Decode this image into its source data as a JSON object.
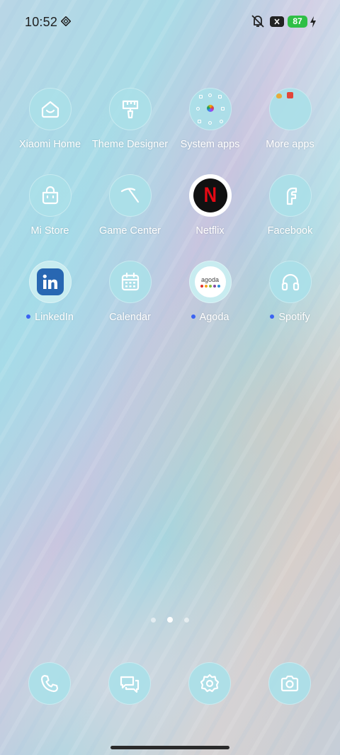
{
  "status_bar": {
    "time": "10:52",
    "icons": [
      "diamond-notification-icon",
      "vibrate-off-icon",
      "x-notification-icon",
      "battery-icon",
      "charging-bolt-icon"
    ],
    "battery_level": "87",
    "battery_color": "#2fbf46"
  },
  "apps": [
    {
      "label": "Xiaomi Home",
      "icon": "xiaomi-home-icon",
      "notification_dot": false
    },
    {
      "label": "Theme Designer",
      "icon": "paint-roller-icon",
      "notification_dot": false
    },
    {
      "label": "System apps",
      "icon": "folder-icon",
      "notification_dot": false
    },
    {
      "label": "More apps",
      "icon": "folder-icon",
      "notification_dot": false
    },
    {
      "label": "Mi Store",
      "icon": "shopping-bag-icon",
      "notification_dot": false
    },
    {
      "label": "Game Center",
      "icon": "game-center-icon",
      "notification_dot": false
    },
    {
      "label": "Netflix",
      "icon": "netflix-icon",
      "notification_dot": false
    },
    {
      "label": "Facebook",
      "icon": "facebook-icon",
      "notification_dot": false
    },
    {
      "label": "LinkedIn",
      "icon": "linkedin-icon",
      "notification_dot": true
    },
    {
      "label": "Calendar",
      "icon": "calendar-icon",
      "notification_dot": false
    },
    {
      "label": "Agoda",
      "icon": "agoda-icon",
      "notification_dot": true
    },
    {
      "label": "Spotify",
      "icon": "headphones-icon",
      "notification_dot": true
    }
  ],
  "agoda_logo_text": "agoda",
  "netflix_logo_text": "N",
  "page_indicator": {
    "pages": 3,
    "current": 2
  },
  "dock": [
    {
      "icon": "phone-icon"
    },
    {
      "icon": "messages-icon"
    },
    {
      "icon": "settings-gear-icon"
    },
    {
      "icon": "camera-icon"
    }
  ],
  "colors": {
    "icon_bubble": "#aae0e8",
    "notification_dot": "#3b63f2",
    "linkedin_blue": "#2867b2",
    "netflix_red": "#e50914"
  }
}
